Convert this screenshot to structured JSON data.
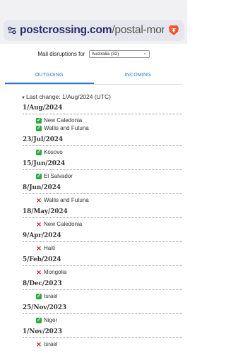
{
  "browser": {
    "url_host": "postcrossing.com",
    "url_path": "/postal-monitor/AU"
  },
  "selector": {
    "label": "Mail disruptions for",
    "value": "Australia (32)"
  },
  "tabs": [
    {
      "label": "OUTGOING",
      "active": true
    },
    {
      "label": "INCOMING",
      "active": false
    }
  ],
  "last_change": "Last change: 1/Aug/2024 (UTC)",
  "entries": [
    {
      "date": "1/Aug/2024",
      "items": [
        {
          "status": "ok",
          "country": "New Caledonia"
        },
        {
          "status": "ok",
          "country": "Wallis and Futuna"
        }
      ]
    },
    {
      "date": "23/Jul/2024",
      "items": [
        {
          "status": "ok",
          "country": "Kosovo"
        }
      ]
    },
    {
      "date": "15/Jun/2024",
      "items": [
        {
          "status": "ok",
          "country": "El Salvador"
        }
      ]
    },
    {
      "date": "8/Jun/2024",
      "items": [
        {
          "status": "no",
          "country": "Wallis and Futuna"
        }
      ]
    },
    {
      "date": "18/May/2024",
      "items": [
        {
          "status": "no",
          "country": "New Caledonia"
        }
      ]
    },
    {
      "date": "9/Apr/2024",
      "items": [
        {
          "status": "no",
          "country": "Haiti"
        }
      ]
    },
    {
      "date": "5/Feb/2024",
      "items": [
        {
          "status": "no",
          "country": "Mongolia"
        }
      ]
    },
    {
      "date": "8/Dec/2023",
      "items": [
        {
          "status": "ok",
          "country": "Israel"
        }
      ]
    },
    {
      "date": "25/Nov/2023",
      "items": [
        {
          "status": "ok",
          "country": "Niger"
        }
      ]
    },
    {
      "date": "1/Nov/2023",
      "items": [
        {
          "status": "no",
          "country": "Israel"
        }
      ]
    }
  ],
  "icons": {
    "resumed": "check-mark-icon",
    "suspended": "cross-mark-icon",
    "site_info": "tune-icon",
    "browser": "brave-lion-icon"
  },
  "colors": {
    "accent": "#2a78c5",
    "ok": "#2eaa3f",
    "no": "#d8232a",
    "url_host": "#2b2b6b"
  }
}
